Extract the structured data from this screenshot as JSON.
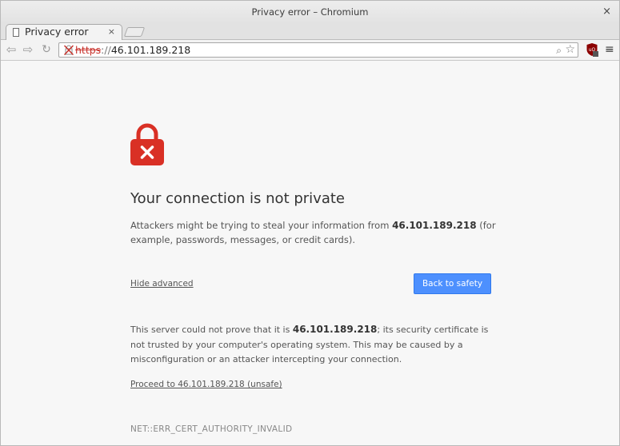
{
  "window": {
    "title": "Privacy error – Chromium",
    "close_glyph": "×"
  },
  "tab": {
    "title": "Privacy error",
    "close_glyph": "×"
  },
  "toolbar": {
    "back_glyph": "⇦",
    "forward_glyph": "⇨",
    "reload_glyph": "↻",
    "url_scheme": "https",
    "url_separator": "://",
    "url_host": "46.101.189.218",
    "zoom_glyph": "⌕",
    "star_glyph": "☆",
    "menu_glyph": "≡"
  },
  "icons": {
    "tab_favicon": "page-icon",
    "security": "broken-lock-icon",
    "extension": "ublock-icon",
    "padlock": "red-padlock-icon"
  },
  "colors": {
    "accent": "#4d90fe",
    "danger": "#c8312b",
    "padlock": "#d93025"
  },
  "interstitial": {
    "heading": "Your connection is not private",
    "p1_before": "Attackers might be trying to steal your information from ",
    "p1_host": "46.101.189.218",
    "p1_after": " (for example, passwords, messages, or credit cards).",
    "hide_advanced": "Hide advanced",
    "back_to_safety": "Back to safety",
    "p2_before": "This server could not prove that it is ",
    "p2_host": "46.101.189.218",
    "p2_after": "; its security certificate is not trusted by your computer's operating system. This may be caused by a misconfiguration or an attacker intercepting your connection.",
    "proceed_link": "Proceed to 46.101.189.218 (unsafe)",
    "error_code": "NET::ERR_CERT_AUTHORITY_INVALID"
  }
}
